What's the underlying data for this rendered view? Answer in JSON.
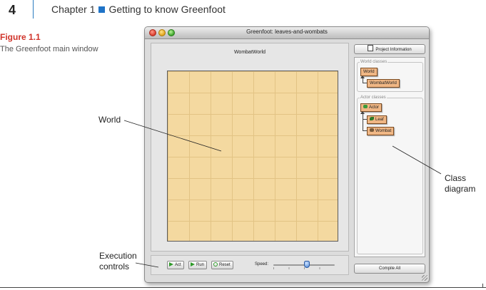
{
  "page": {
    "number": "4",
    "chapter_title": "Chapter 1",
    "chapter_subtitle": "Getting to know Greenfoot"
  },
  "figure": {
    "title": "Figure 1.1",
    "caption": "The Greenfoot main window"
  },
  "callouts": {
    "world": "World",
    "class_diagram_line1": "Class",
    "class_diagram_line2": "diagram",
    "execution_line1": "Execution",
    "execution_line2": "controls"
  },
  "window": {
    "title": "Greenfoot: leaves-and-wombats",
    "world_name": "WombatWorld",
    "project_info_label": "Project Information",
    "compile_all_label": "Compile All"
  },
  "classes": {
    "world_group_label": "World classes",
    "world_classes": [
      "World",
      "WombatWorld"
    ],
    "actor_group_label": "Actor classes",
    "actor_classes": [
      "Actor",
      "Leaf",
      "Wombat"
    ]
  },
  "controls": {
    "act_label": "Act",
    "run_label": "Run",
    "reset_label": "Reset",
    "speed_label": "Speed:",
    "speed_value": 0.55
  },
  "colors": {
    "figure_title": "#d0332a",
    "chapter_square": "#1f73c7",
    "world_background": "#f4d9a0",
    "class_box": "#f0b785"
  }
}
